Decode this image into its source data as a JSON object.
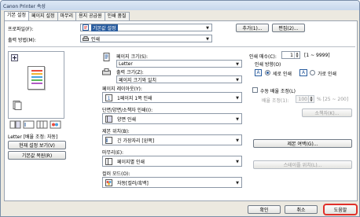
{
  "window": {
    "title": "Canon Printer 속성"
  },
  "tabs": [
    "기본 설정",
    "페이지 설정",
    "마무리",
    "용지 공급원",
    "인쇄 품질"
  ],
  "profile": {
    "label": "프로파일(F):",
    "value": "기본값 설정",
    "add_button": "추가(1)...",
    "edit_button": "편집(2)..."
  },
  "output": {
    "label": "출력 방법(M):",
    "value": "인쇄"
  },
  "preview": {
    "caption": "Letter [배율 조정: 자동]",
    "view_button": "현재 설정 보기(V)",
    "restore_button": "기본값 복원(R)"
  },
  "page_size": {
    "label": "페이지 크기(S):",
    "value": "Letter"
  },
  "output_size": {
    "label": "출력 크기(Z):",
    "value": "페이지 크기와 일치"
  },
  "page_layout": {
    "label": "페이지 레이아웃(Y):",
    "value": "1페이지 1쪽 인쇄"
  },
  "duplex": {
    "label": "단면/양면/소책자 인쇄(I):",
    "value": "양면 인쇄"
  },
  "binding": {
    "label": "제본 위치(B):",
    "value": "긴 가장자리 [왼쪽]",
    "button": "제본 여백(G)..."
  },
  "finishing": {
    "label": "마무리(E):",
    "value": "페이지별 인쇄",
    "button": "스테이플 위치(L)..."
  },
  "color_mode": {
    "label": "컬러 모드(O):",
    "value": "자동[컬러/흑백]"
  },
  "copies": {
    "label": "인쇄 매수(C):",
    "value": "1",
    "range": "[1 ~ 9999]"
  },
  "orientation": {
    "label": "인쇄 방향(O)",
    "portrait_label": "세로 인쇄",
    "landscape_label": "가로 인쇄",
    "selected": "portrait",
    "icon_letter": "A"
  },
  "manual_scaling": {
    "label": "수동 배율 조정(L)",
    "scale_label": "배율 조정(1):",
    "value": "100",
    "range": "% [25 ~ 200]"
  },
  "booklet_button": "소책자(K)...",
  "footer": {
    "ok": "확인",
    "cancel": "취소",
    "help": "도움말"
  },
  "colors": {
    "accent": "#2a5d9f",
    "help_outline": "#e0302a"
  }
}
